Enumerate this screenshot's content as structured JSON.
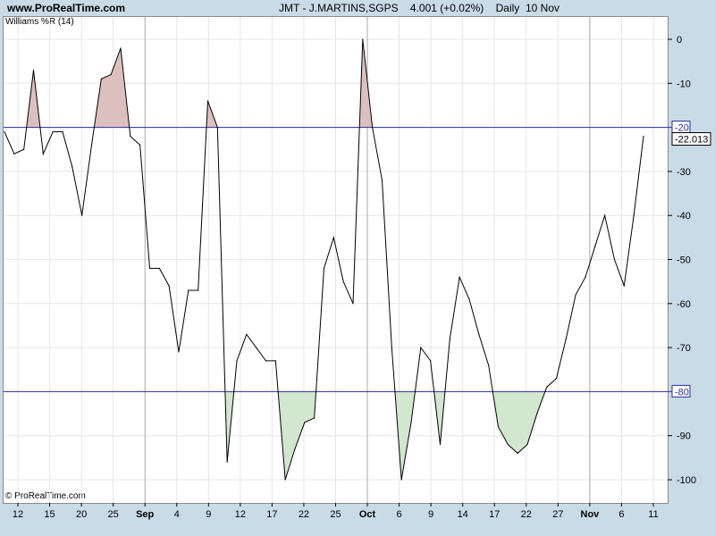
{
  "header": {
    "site": "www.ProRealTime.com",
    "title": "JMT - J.MARTINS,SGPS    4.001 (+0.02%)    Daily  10 Nov"
  },
  "indicator_label": "Williams %R (14)",
  "credit": "© ProRealTime.com",
  "colors": {
    "background": "#c9dbe6",
    "plot_bg": "#ffffff",
    "line": "#000000",
    "threshold": "#2b2b9a",
    "overbought_fill": "#dcc0c0",
    "oversold_fill": "#d2e6d0",
    "grid": "#e6e6e6"
  },
  "chart_data": {
    "type": "line",
    "title": "",
    "xlabel": "",
    "ylabel": "",
    "ylim": [
      -100,
      0
    ],
    "grid": true,
    "y_ticks": [
      0,
      -10,
      -30,
      -40,
      -50,
      -60,
      -70,
      -90,
      -100
    ],
    "y_tick_labels": [
      "0",
      "-10",
      "-30",
      "-40",
      "-50",
      "-60",
      "-70",
      "-90",
      "-100"
    ],
    "thresholds": [
      {
        "value": -20,
        "label": "-20"
      },
      {
        "value": -80,
        "label": "-80"
      }
    ],
    "last_value_label": "-22.013",
    "last_value": -22.013,
    "x_tick_labels": [
      "12",
      "15",
      "20",
      "25",
      "Sep",
      "4",
      "9",
      "12",
      "17",
      "22",
      "25",
      "Oct",
      "6",
      "9",
      "14",
      "17",
      "22",
      "27",
      "Nov",
      "6",
      "11"
    ],
    "x_month_labels": [
      "Sep",
      "Oct",
      "Nov"
    ],
    "series": [
      {
        "name": "",
        "values": [
          -21,
          -26,
          -25,
          -7,
          -26,
          -21,
          -21,
          -29,
          -40,
          -24,
          -9,
          -8,
          -2,
          -22,
          -24,
          -52,
          -52,
          -56,
          -71,
          -57,
          -57,
          -14,
          -20,
          -96,
          -73,
          -67,
          -70,
          -73,
          -73,
          -100,
          -93,
          -87,
          -86,
          -52,
          -45,
          -55,
          -60,
          0,
          -20,
          -32,
          -70,
          -100,
          -87,
          -70,
          -73,
          -92,
          -68,
          -54,
          -59,
          -67,
          -74,
          -88,
          -92,
          -94,
          -92,
          -85,
          -79,
          -77,
          -68,
          -58,
          -54,
          -47,
          -40,
          -50,
          -56,
          -40,
          -22.013
        ]
      }
    ]
  }
}
